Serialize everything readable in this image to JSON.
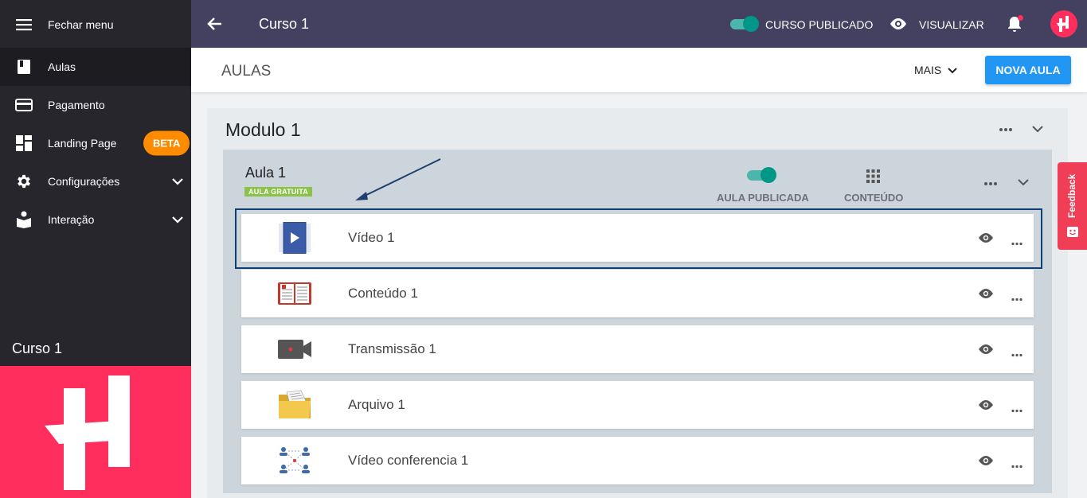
{
  "sidebar": {
    "close_menu": "Fechar menu",
    "items": [
      {
        "label": "Aulas",
        "icon": "book-icon",
        "active": true
      },
      {
        "label": "Pagamento",
        "icon": "credit-card-icon"
      },
      {
        "label": "Landing Page",
        "icon": "dashboard-icon",
        "badge": "BETA"
      },
      {
        "label": "Configurações",
        "icon": "gear-icon",
        "expandable": true
      },
      {
        "label": "Interação",
        "icon": "reading-person-icon",
        "expandable": true
      }
    ],
    "course_name": "Curso 1"
  },
  "topbar": {
    "title": "Curso 1",
    "published_label": "CURSO PUBLICADO",
    "published": true,
    "view_label": "VISUALIZAR"
  },
  "subheader": {
    "title": "AULAS",
    "more_label": "MAIS",
    "new_button": "NOVA AULA"
  },
  "module": {
    "title": "Modulo 1",
    "lesson": {
      "title": "Aula 1",
      "badge": "AULA GRATUITA",
      "published_label": "AULA PUBLICADA",
      "published": true,
      "content_label": "CONTEÚDO",
      "items": [
        {
          "name": "Vídeo 1",
          "icon": "video-file-icon"
        },
        {
          "name": "Conteúdo 1",
          "icon": "open-book-icon"
        },
        {
          "name": "Transmissão 1",
          "icon": "video-camera-icon"
        },
        {
          "name": "Arquivo 1",
          "icon": "folder-icon"
        },
        {
          "name": "Vídeo conferencia 1",
          "icon": "conference-icon"
        }
      ]
    }
  },
  "feedback_label": "Feedback",
  "colors": {
    "sidebar_bg": "#26262c",
    "topbar_bg": "#43415f",
    "brand_pink": "#ff2e5c",
    "primary_blue": "#2196f3",
    "toggle_teal": "#009688",
    "beta_orange": "#ff8c00"
  }
}
